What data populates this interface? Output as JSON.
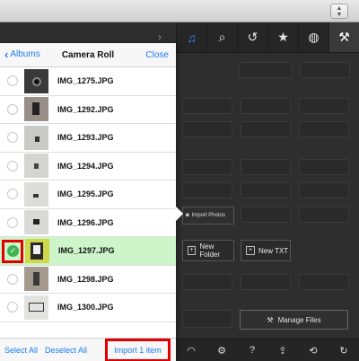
{
  "browser": {
    "stepper_icon": "stepper-icon"
  },
  "toolbar": {
    "tools": [
      {
        "icon": "music-icon",
        "glyph": "♫"
      },
      {
        "icon": "search-icon",
        "glyph": "⌕"
      },
      {
        "icon": "history-icon",
        "glyph": "↺"
      },
      {
        "icon": "star-icon",
        "glyph": "★"
      },
      {
        "icon": "globe-icon",
        "glyph": "◍"
      },
      {
        "icon": "tools-icon",
        "glyph": "⚒"
      }
    ]
  },
  "panel": {
    "import_photos": "Import Photos",
    "new_folder": "New Folder",
    "new_txt": "New TXT",
    "manage_files": "Manage Files"
  },
  "bottombar": {
    "icons": [
      {
        "icon": "wifi-icon",
        "glyph": "◠"
      },
      {
        "icon": "gear-icon",
        "glyph": "⚙"
      },
      {
        "icon": "help-icon",
        "glyph": "?"
      },
      {
        "icon": "share-icon",
        "glyph": "⇪"
      },
      {
        "icon": "sync-icon",
        "glyph": "⟲"
      },
      {
        "icon": "refresh-icon",
        "glyph": "↻"
      }
    ]
  },
  "popover": {
    "back_label": "Albums",
    "title": "Camera Roll",
    "close_label": "Close",
    "photos": [
      {
        "name": "IMG_1275.JPG",
        "selected": false
      },
      {
        "name": "IMG_1292.JPG",
        "selected": false
      },
      {
        "name": "IMG_1293.JPG",
        "selected": false
      },
      {
        "name": "IMG_1294.JPG",
        "selected": false
      },
      {
        "name": "IMG_1295.JPG",
        "selected": false
      },
      {
        "name": "IMG_1296.JPG",
        "selected": false
      },
      {
        "name": "IMG_1297.JPG",
        "selected": true
      },
      {
        "name": "IMG_1298.JPG",
        "selected": false
      },
      {
        "name": "IMG_1300.JPG",
        "selected": false
      }
    ],
    "footer": {
      "select_all": "Select All",
      "deselect_all": "Deselect All",
      "import": "Import 1 item"
    }
  },
  "colors": {
    "accent": "#1a7cf4",
    "selected_row": "#cdf5c9",
    "highlight": "#e00000",
    "check": "#3fb34f"
  }
}
